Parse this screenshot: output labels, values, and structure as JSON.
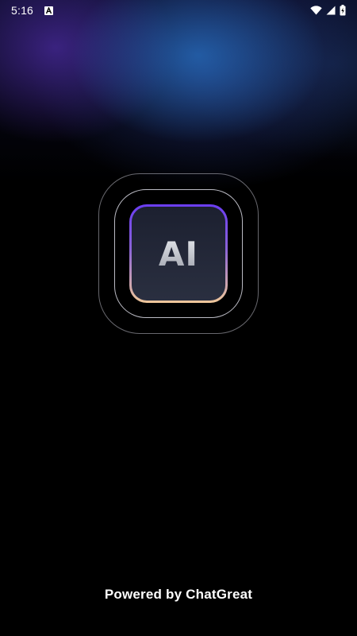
{
  "status_bar": {
    "time": "5:16",
    "notification_icon": "a-letter-icon",
    "icons": [
      "wifi-icon",
      "cellular-signal-icon",
      "battery-charging-icon"
    ]
  },
  "splash": {
    "logo_text": "AI",
    "logo_icon": "ai-app-icon",
    "footer": "Powered by ChatGreat"
  },
  "colors": {
    "background": "#000000",
    "tile_border_top": "#6b3df2",
    "tile_border_bottom": "#f0c79a",
    "tile_fill": "#1c2030",
    "glow_purple": "#462896",
    "glow_blue": "#266ebe"
  }
}
